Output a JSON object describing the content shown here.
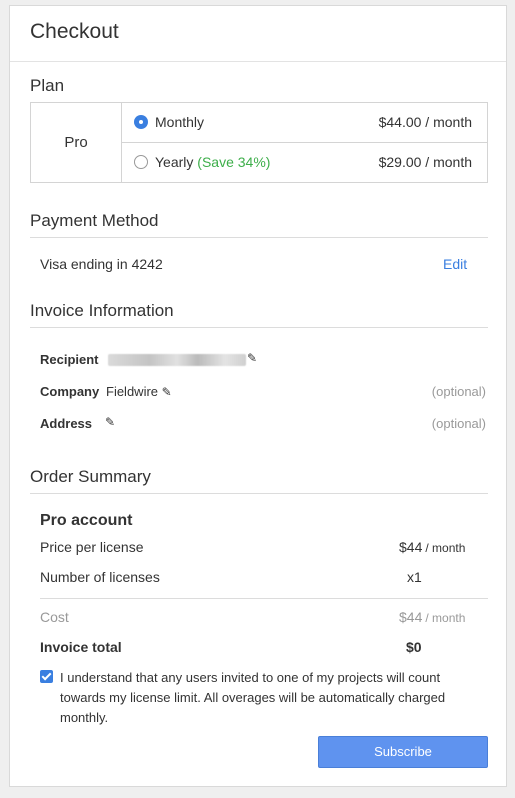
{
  "header": {
    "title": "Checkout"
  },
  "plan": {
    "section_title": "Plan",
    "name": "Pro",
    "options": [
      {
        "label": "Monthly",
        "note": "",
        "price": "$44.00 / month",
        "selected": true
      },
      {
        "label": "Yearly",
        "note": "(Save 34%)",
        "price": "$29.00 / month",
        "selected": false
      }
    ]
  },
  "payment": {
    "section_title": "Payment Method",
    "card_text": "Visa ending in 4242",
    "edit_label": "Edit"
  },
  "invoice": {
    "section_title": "Invoice Information",
    "recipient_label": "Recipient",
    "company_label": "Company",
    "company_value": "Fieldwire",
    "address_label": "Address",
    "optional_text": "(optional)"
  },
  "order": {
    "section_title": "Order Summary",
    "product": "Pro account",
    "price_label": "Price per license",
    "price_value": "$44",
    "price_unit": "/ month",
    "licenses_label": "Number of licenses",
    "licenses_value": "x1",
    "cost_label": "Cost",
    "cost_value": "$44",
    "cost_unit": "/ month",
    "total_label": "Invoice total",
    "total_value": "$0"
  },
  "agreement": {
    "checked": true,
    "text": "I understand that any users invited to one of my projects will count towards my license limit. All overages will be automatically charged monthly."
  },
  "subscribe_label": "Subscribe",
  "colors": {
    "accent": "#3a7fe0",
    "save_green": "#3dae4a",
    "button": "#5f93ef"
  },
  "icons": [
    "pencil-icon",
    "radio-selected-icon",
    "checkbox-checked-icon"
  ]
}
